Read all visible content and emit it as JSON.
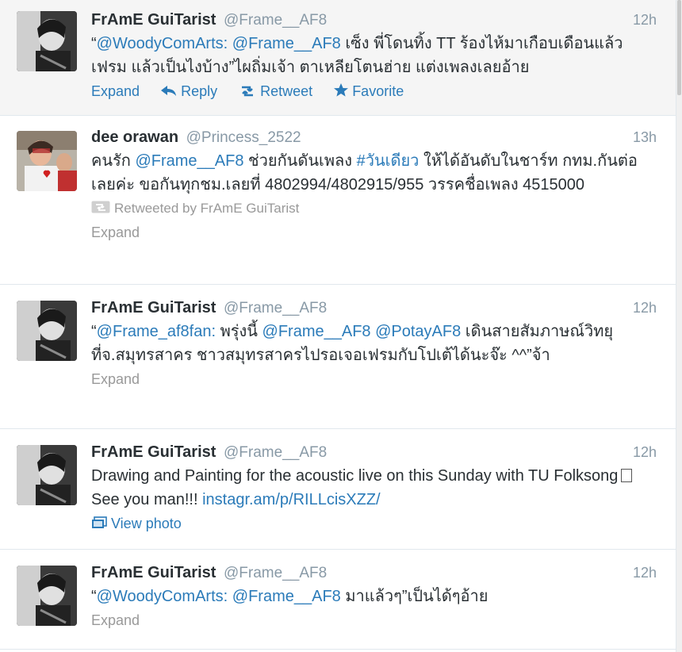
{
  "tweets": [
    {
      "fullname": "FrAmE GuiTarist",
      "username": "@Frame__AF8",
      "time": "12h",
      "text_parts": [
        "“",
        "@WoodyComArts:",
        " ",
        "@Frame__AF8",
        " เซ็ง พี่โดนทิ้ง TT ร้องไห้มาเกือบเดือนแล้วเฟรม แล้วเป็นไงบ้าง”ไผถิ่มเจ้า ตาเหลียโตนฮ่าย แต่งเพลงเลยอ้าย"
      ],
      "actions": {
        "expand": "Expand",
        "reply": "Reply",
        "retweet": "Retweet",
        "favorite": "Favorite"
      }
    },
    {
      "fullname": "dee orawan",
      "username": "@Princess_2522",
      "time": "13h",
      "text_parts": [
        "คนรัก ",
        "@Frame__AF8",
        " ช่วยกันดันเพลง ",
        "#วันเดียว",
        " ให้ได้อันดับในชาร์ท กทม.กันต่อเลยค่ะ ขอกันทุกชม.เลยที่ 4802994/4802915/955 วรรคชื่อเพลง 4515000"
      ],
      "retweeted_by": "Retweeted by FrAmE GuiTarist",
      "expand": "Expand"
    },
    {
      "fullname": "FrAmE GuiTarist",
      "username": "@Frame__AF8",
      "time": "12h",
      "text_parts": [
        "“",
        "@Frame_af8fan:",
        " พรุ่งนี้ ",
        "@Frame__AF8",
        " ",
        "@PotayAF8",
        " เดินสายสัมภาษณ์วิทยุ ที่จ.สมุทรสาคร ชาวสมุทรสาครไปรอเจอเฟรมกับโปเต้ได้นะจ๊ะ ^^”จ้า"
      ],
      "expand": "Expand"
    },
    {
      "fullname": "FrAmE GuiTarist",
      "username": "@Frame__AF8",
      "time": "12h",
      "text_before": "Drawing and Painting for the acoustic live on this Sunday with TU Folksong",
      "text_after": " See you man!!! ",
      "link": "instagr.am/p/RILLcisXZZ/",
      "view_photo": "View photo"
    },
    {
      "fullname": "FrAmE GuiTarist",
      "username": "@Frame__AF8",
      "time": "12h",
      "text_parts": [
        "“",
        "@WoodyComArts:",
        " ",
        "@Frame__AF8",
        " มาแล้วๆ”เป็นได้ๆอ้าย"
      ],
      "expand": "Expand"
    }
  ],
  "colors": {
    "link": "#2b7bb9",
    "muted": "#8899a6",
    "highlight_bg": "#f5f5f5"
  },
  "icons": {
    "reply": "reply-arrow-icon",
    "retweet": "retweet-icon",
    "favorite": "star-icon",
    "photo": "photo-icon",
    "retweeted": "retweeted-icon"
  }
}
